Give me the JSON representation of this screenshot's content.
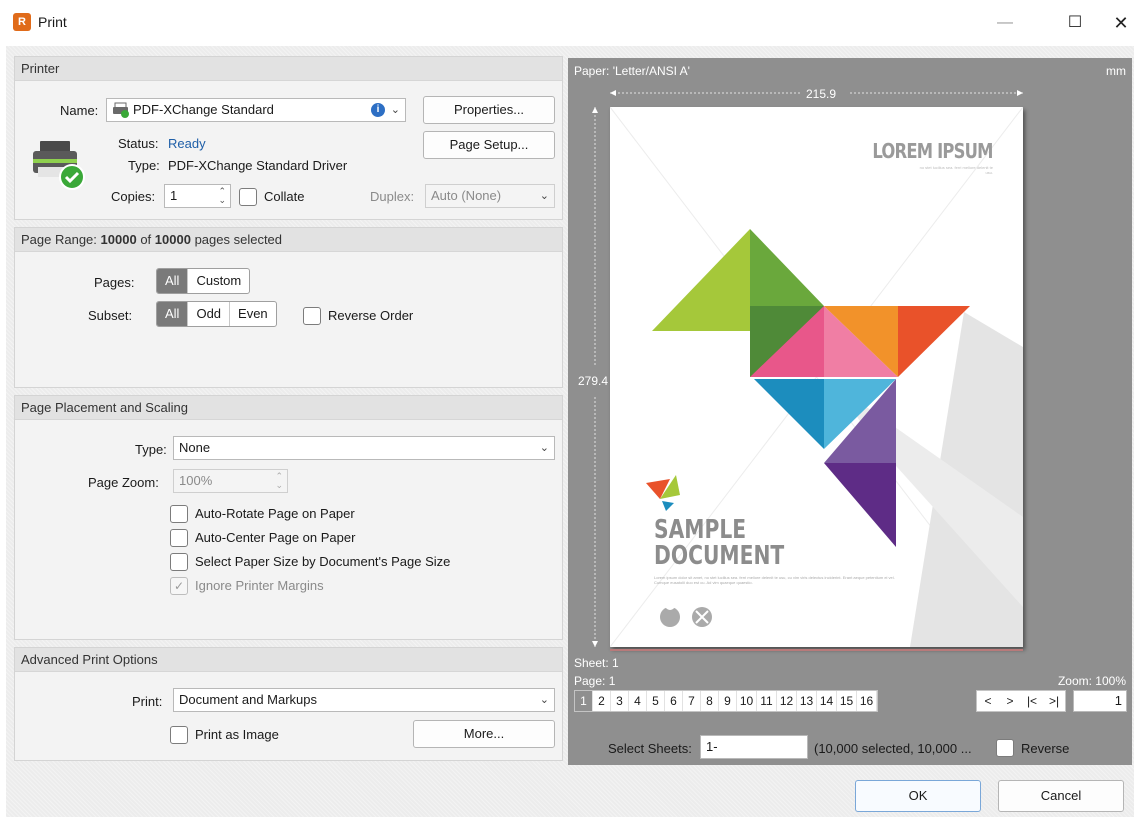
{
  "window": {
    "title": "Print",
    "app_icon_glyph": "R",
    "minimize_glyph": "—",
    "maximize_glyph": "☐",
    "close_glyph": "✕"
  },
  "printer": {
    "header": "Printer",
    "name_label": "Name:",
    "name_value": "PDF-XChange Standard",
    "info_glyph": "i",
    "properties_button": "Properties...",
    "page_setup_button": "Page Setup...",
    "status_label": "Status:",
    "status_value": "Ready",
    "type_label": "Type:",
    "type_value": "PDF-XChange Standard Driver",
    "copies_label": "Copies:",
    "copies_value": "1",
    "collate_label": "Collate",
    "duplex_label": "Duplex:",
    "duplex_value": "Auto (None)"
  },
  "page_range": {
    "header_prefix": "Page Range:",
    "selected_count": "10000",
    "of_text": "of",
    "total_count": "10000",
    "header_suffix": "pages selected",
    "pages_label": "Pages:",
    "pages_options": [
      "All",
      "Custom"
    ],
    "pages_selected": "All",
    "subset_label": "Subset:",
    "subset_options": [
      "All",
      "Odd",
      "Even"
    ],
    "subset_selected": "All",
    "reverse_order_label": "Reverse Order"
  },
  "placement": {
    "header": "Page Placement and Scaling",
    "type_label": "Type:",
    "type_value": "None",
    "zoom_label": "Page Zoom:",
    "zoom_value": "100%",
    "options": [
      {
        "label": "Auto-Rotate Page on Paper",
        "checked": false,
        "disabled": false
      },
      {
        "label": "Auto-Center Page on Paper",
        "checked": false,
        "disabled": false
      },
      {
        "label": "Select Paper Size by Document's Page Size",
        "checked": false,
        "disabled": false
      },
      {
        "label": "Ignore Printer Margins",
        "checked": true,
        "disabled": true
      }
    ]
  },
  "advanced": {
    "header": "Advanced Print Options",
    "print_label": "Print:",
    "print_value": "Document and Markups",
    "print_as_image_label": "Print as Image",
    "more_button": "More..."
  },
  "preview": {
    "paper_label": "Paper: 'Letter/ANSI A'",
    "unit": "mm",
    "width_value": "215.9",
    "height_value": "279.4",
    "sheet_text": "Sheet: 1",
    "page_text": "Page: 1",
    "zoom_text": "Zoom: 100%",
    "sheets": [
      "1",
      "2",
      "3",
      "4",
      "5",
      "6",
      "7",
      "8",
      "9",
      "10",
      "11",
      "12",
      "13",
      "14",
      "15",
      "16"
    ],
    "current_sheet": "1",
    "nav": [
      "<",
      ">",
      "|<",
      ">|"
    ],
    "sheet_input_value": "1",
    "select_sheets_label": "Select Sheets:",
    "select_sheets_value": "1-",
    "selected_info": "(10,000 selected, 10,000 ...",
    "reverse_label": "Reverse",
    "doc": {
      "header_title": "LOREM IPSUM",
      "header_sub": "no stet lucilius sea. ferri meliore delenit te usu.",
      "main_title_1": "SAMPLE",
      "main_title_2": "DOCUMENT",
      "body_text": "Lorem ipsum dolor sit amet, no stet lucilius sea. ferri meliore delenit te usu, cu vim viris delectus inciderint. Erant aeque petentium ei vel. Cumque eusatolii duo est cu. Ad vim quaeque quaestio."
    },
    "colors": {
      "lime": "#a5c83a",
      "green": "#6aa83c",
      "darkgreen": "#4f8a38",
      "orange": "#f2922a",
      "red": "#e9522a",
      "pink": "#e8578a",
      "lightpink": "#f07ea4",
      "teal": "#1c8dbe",
      "lightteal": "#4fb5db",
      "mauve": "#7a5aa0",
      "purple": "#5e2c86"
    }
  },
  "buttons": {
    "ok": "OK",
    "cancel": "Cancel"
  }
}
